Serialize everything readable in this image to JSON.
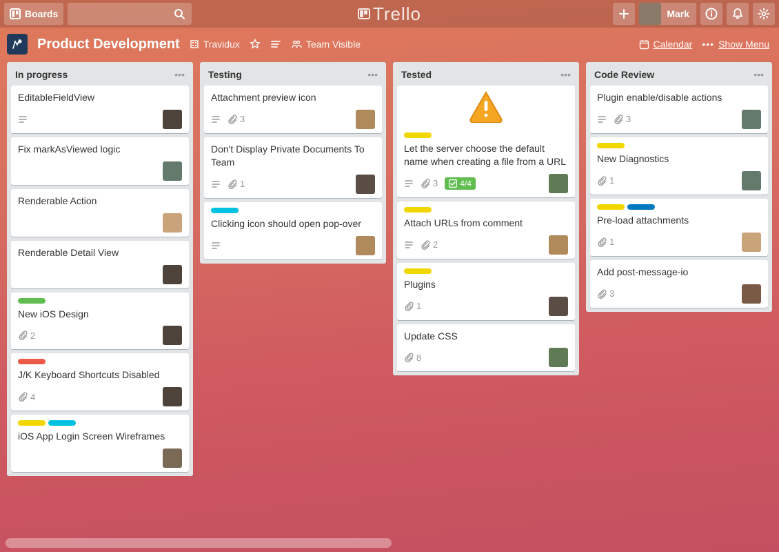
{
  "topbar": {
    "boards_label": "Boards",
    "logo_text": "Trello",
    "user_name": "Mark"
  },
  "boardhdr": {
    "title": "Product Development",
    "team": "Travidux",
    "visibility": "Team Visible",
    "calendar": "Calendar",
    "show_menu": "Show Menu"
  },
  "lists": [
    {
      "title": "In progress",
      "cards": [
        {
          "title": "EditableFieldView",
          "desc": true,
          "avatar": "a1"
        },
        {
          "title": "Fix markAsViewed logic",
          "avatar": "a2"
        },
        {
          "title": "Renderable Action",
          "avatar": "a3"
        },
        {
          "title": "Renderable Detail View",
          "avatar": "a1"
        },
        {
          "labels": [
            "green"
          ],
          "title": "New iOS Design",
          "attachments": 2,
          "avatar": "a1"
        },
        {
          "labels": [
            "orange"
          ],
          "title": "J/K Keyboard Shortcuts Disabled",
          "attachments": 4,
          "avatar": "a1"
        },
        {
          "labels": [
            "yellow",
            "cyan"
          ],
          "title": "iOS App Login Screen Wireframes",
          "avatar": "a4"
        }
      ]
    },
    {
      "title": "Testing",
      "cards": [
        {
          "title": "Attachment preview icon",
          "desc": true,
          "attachments": 3,
          "avatar": "a5"
        },
        {
          "title": "Don't Display Private Documents To Team",
          "desc": true,
          "attachments": 1,
          "avatar": "a6"
        },
        {
          "labels": [
            "cyan"
          ],
          "title": "Clicking icon should open pop-over",
          "desc": true,
          "avatar": "a5"
        }
      ]
    },
    {
      "title": "Tested",
      "cards": [
        {
          "cover": true,
          "labels": [
            "yellow"
          ],
          "title": "Let the server choose the default name when creating a file from a URL",
          "desc": true,
          "attachments": 3,
          "checklist": "4/4",
          "avatar": "a7"
        },
        {
          "labels": [
            "yellow"
          ],
          "title": "Attach URLs from comment",
          "desc": true,
          "attachments": 2,
          "avatar": "a5"
        },
        {
          "labels": [
            "yellow"
          ],
          "title": "Plugins",
          "attachments": 1,
          "avatar": "a6"
        },
        {
          "title": "Update CSS",
          "attachments": 8,
          "avatar": "a7"
        }
      ]
    },
    {
      "title": "Code Review",
      "cards": [
        {
          "title": "Plugin enable/disable actions",
          "desc": true,
          "attachments": 3,
          "avatar": "a2"
        },
        {
          "labels": [
            "yellow"
          ],
          "title": "New Diagnostics",
          "attachments": 1,
          "avatar": "a2"
        },
        {
          "labels": [
            "yellow",
            "blue"
          ],
          "title": "Pre-load attachments",
          "attachments": 1,
          "avatar": "a3"
        },
        {
          "title": "Add post-message-io",
          "attachments": 3,
          "avatar": "a8"
        }
      ]
    }
  ],
  "avatar_colors": {
    "a1": "#4d433a",
    "a2": "#647a6c",
    "a3": "#c9a47a",
    "a4": "#7a6a55",
    "a5": "#b08a5a",
    "a6": "#5a4d45",
    "a7": "#5f7a55",
    "a8": "#7a5a45"
  }
}
